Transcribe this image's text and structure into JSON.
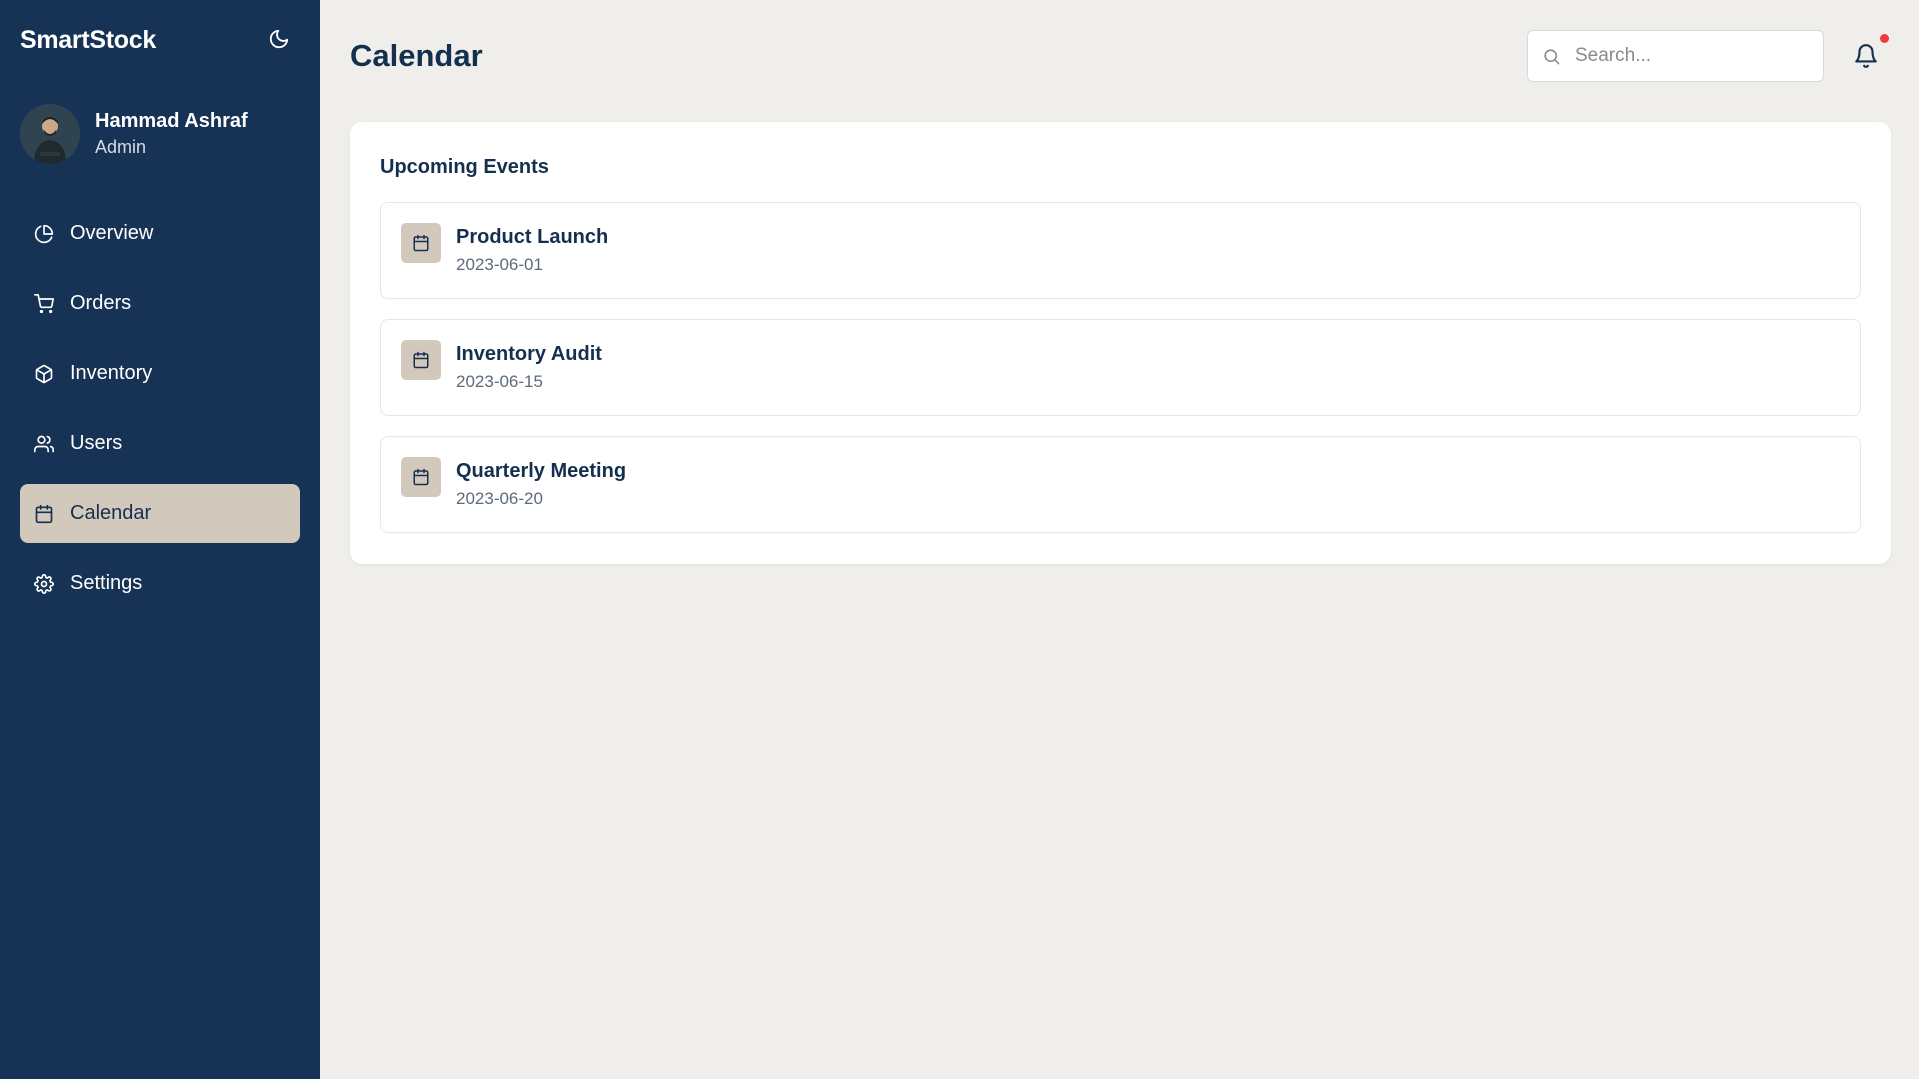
{
  "app": {
    "brand": "SmartStock",
    "theme_icon": "moon-icon"
  },
  "user": {
    "name": "Hammad Ashraf",
    "role": "Admin"
  },
  "sidebar": {
    "items": [
      {
        "label": "Overview",
        "icon": "pie-chart-icon",
        "active": false
      },
      {
        "label": "Orders",
        "icon": "cart-icon",
        "active": false
      },
      {
        "label": "Inventory",
        "icon": "box-icon",
        "active": false
      },
      {
        "label": "Users",
        "icon": "users-icon",
        "active": false
      },
      {
        "label": "Calendar",
        "icon": "calendar-icon",
        "active": true
      },
      {
        "label": "Settings",
        "icon": "gear-icon",
        "active": false
      }
    ]
  },
  "header": {
    "title": "Calendar",
    "search_placeholder": "Search...",
    "search_value": "",
    "notification_icon": "bell-icon",
    "has_unread_notifications": true
  },
  "events_panel": {
    "title": "Upcoming Events",
    "events": [
      {
        "name": "Product Launch",
        "date": "2023-06-01"
      },
      {
        "name": "Inventory Audit",
        "date": "2023-06-15"
      },
      {
        "name": "Quarterly Meeting",
        "date": "2023-06-20"
      }
    ]
  },
  "colors": {
    "sidebar_bg": "#163255",
    "active_item_bg": "#d3c8bc",
    "page_bg": "#f0eeeb",
    "primary_text": "#15304f",
    "notification_dot": "#ef3b3b"
  }
}
